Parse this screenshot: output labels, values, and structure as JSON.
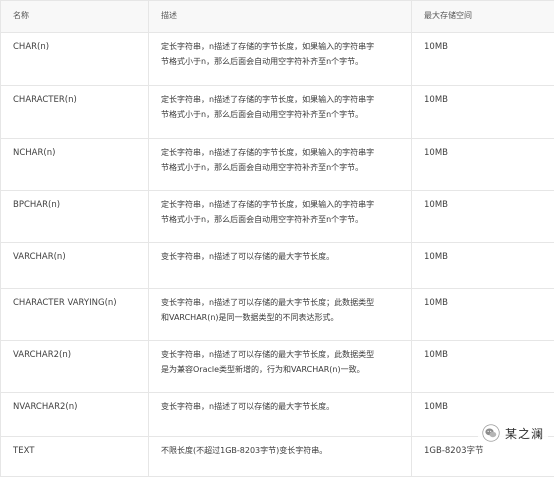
{
  "table": {
    "headers": [
      "名称",
      "描述",
      "最大存储空间"
    ],
    "rows": [
      {
        "name": "CHAR(n)",
        "desc": [
          "定长字符串，n描述了存储的字节长度，如果输入的字符串字",
          "节格式小于n，那么后面会自动用空字符补齐至n个字节。"
        ],
        "size": "10MB"
      },
      {
        "name": "CHARACTER(n)",
        "desc": [
          "定长字符串，n描述了存储的字节长度，如果输入的字符串字",
          "节格式小于n，那么后面会自动用空字符补齐至n个字节。"
        ],
        "size": "10MB"
      },
      {
        "name": "NCHAR(n)",
        "desc": [
          "定长字符串，n描述了存储的字节长度，如果输入的字符串字",
          "节格式小于n，那么后面会自动用空字符补齐至n个字节。"
        ],
        "size": "10MB"
      },
      {
        "name": "BPCHAR(n)",
        "desc": [
          "定长字符串，n描述了存储的字节长度，如果输入的字符串字",
          "节格式小于n，那么后面会自动用空字符补齐至n个字节。"
        ],
        "size": "10MB"
      },
      {
        "name": "VARCHAR(n)",
        "desc": [
          "变长字符串，n描述了可以存储的最大字节长度。"
        ],
        "size": "10MB"
      },
      {
        "name": "CHARACTER VARYING(n)",
        "desc": [
          "变长字符串，n描述了可以存储的最大字节长度；此数据类型",
          "和VARCHAR(n)是同一数据类型的不同表达形式。"
        ],
        "size": "10MB"
      },
      {
        "name": "VARCHAR2(n)",
        "desc": [
          "变长字符串，n描述了可以存储的最大字节长度，此数据类型",
          "是为兼容Oracle类型新增的，行为和VARCHAR(n)一致。"
        ],
        "size": "10MB"
      },
      {
        "name": "NVARCHAR2(n)",
        "desc": [
          "变长字符串，n描述了可以存储的最大字节长度。"
        ],
        "size": "10MB"
      },
      {
        "name": "TEXT",
        "desc": [
          "不限长度(不超过1GB-8203字节)变长字符串。"
        ],
        "size": "1GB-8203字节"
      }
    ]
  },
  "watermark": {
    "text": "某之澜",
    "icon": "wechat-logo-icon"
  }
}
